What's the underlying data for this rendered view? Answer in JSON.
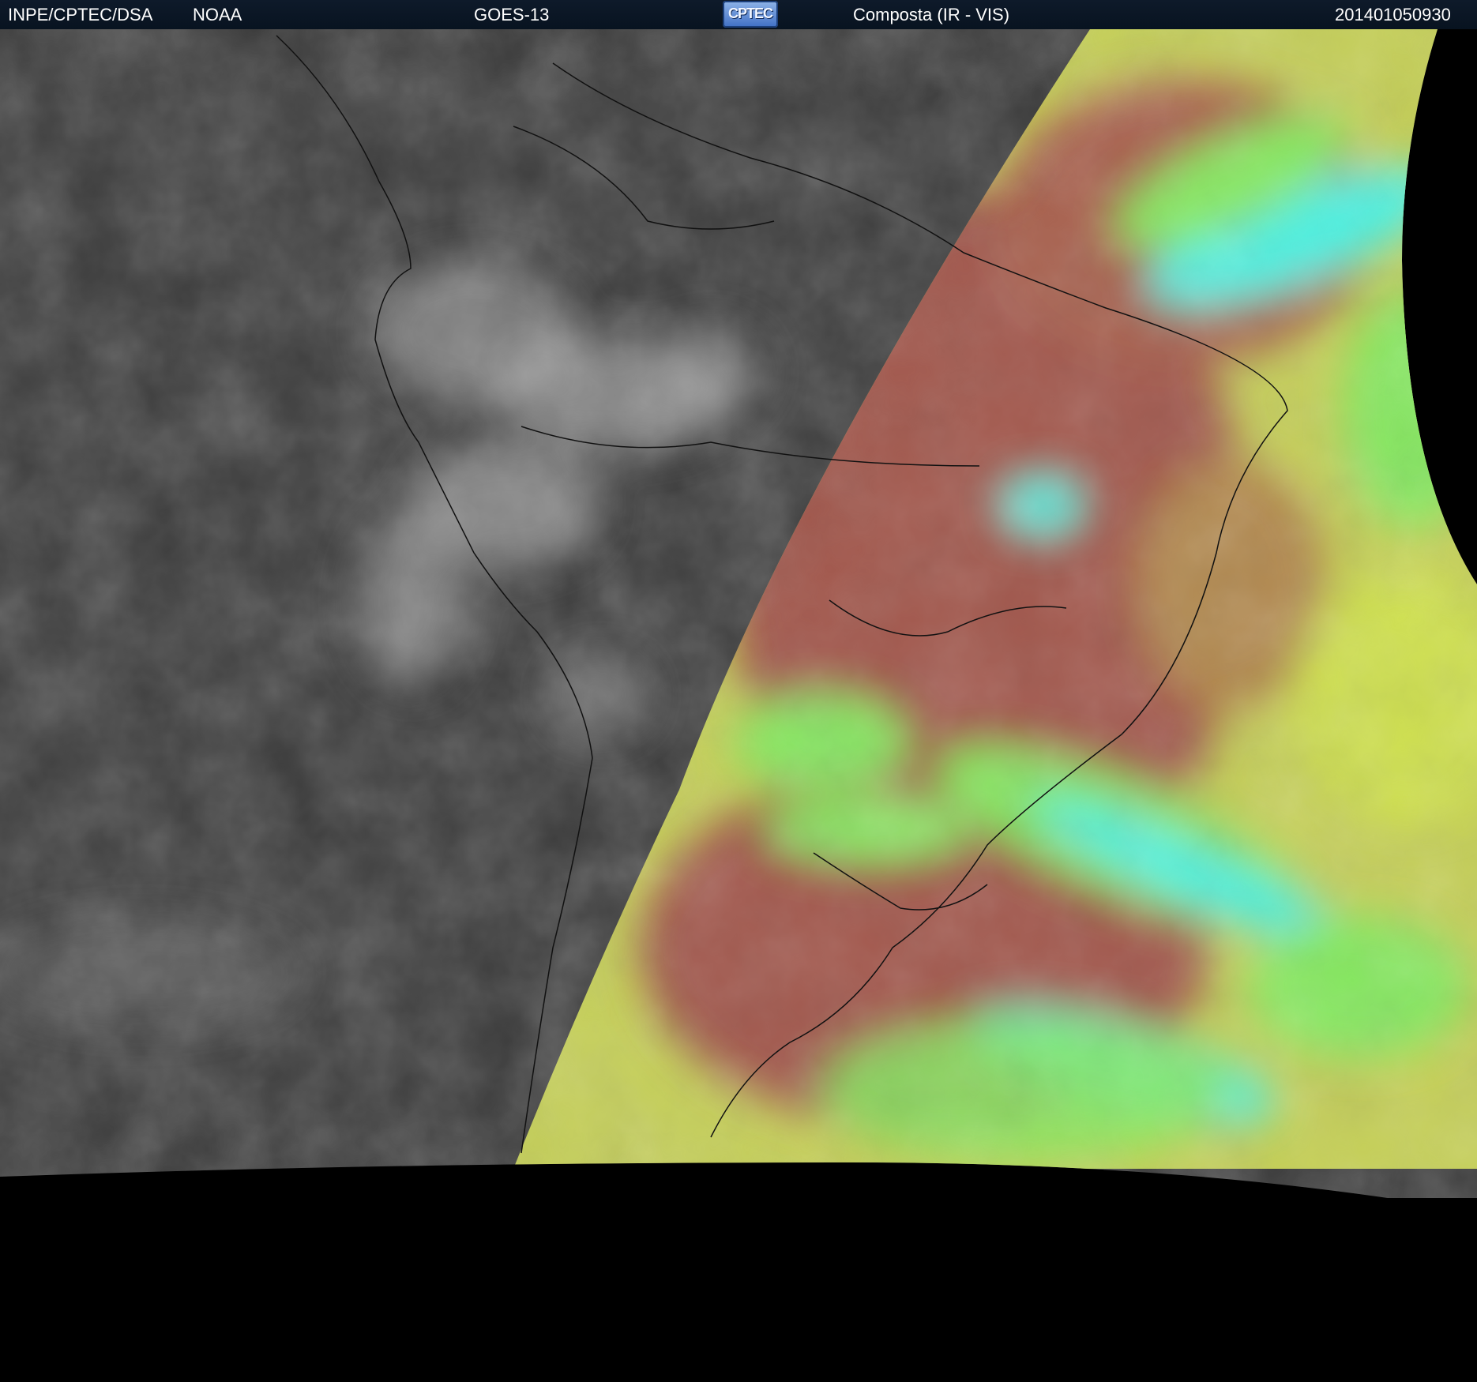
{
  "header": {
    "institution": "INPE/CPTEC/DSA",
    "agency": "NOAA",
    "satellite": "GOES-13",
    "logo_text": "CPTEC",
    "product": "Composta (IR - VIS)",
    "timestamp": "201401050930"
  },
  "colors": {
    "header_bg": "#0b1727",
    "night_ir": "#3c3c3c",
    "day_land": "#a2584e",
    "day_cloud_green": "#86e860",
    "day_cloud_cyan": "#4ff0e0",
    "day_ocean_yellow": "#c9d45a",
    "space": "#000000"
  }
}
